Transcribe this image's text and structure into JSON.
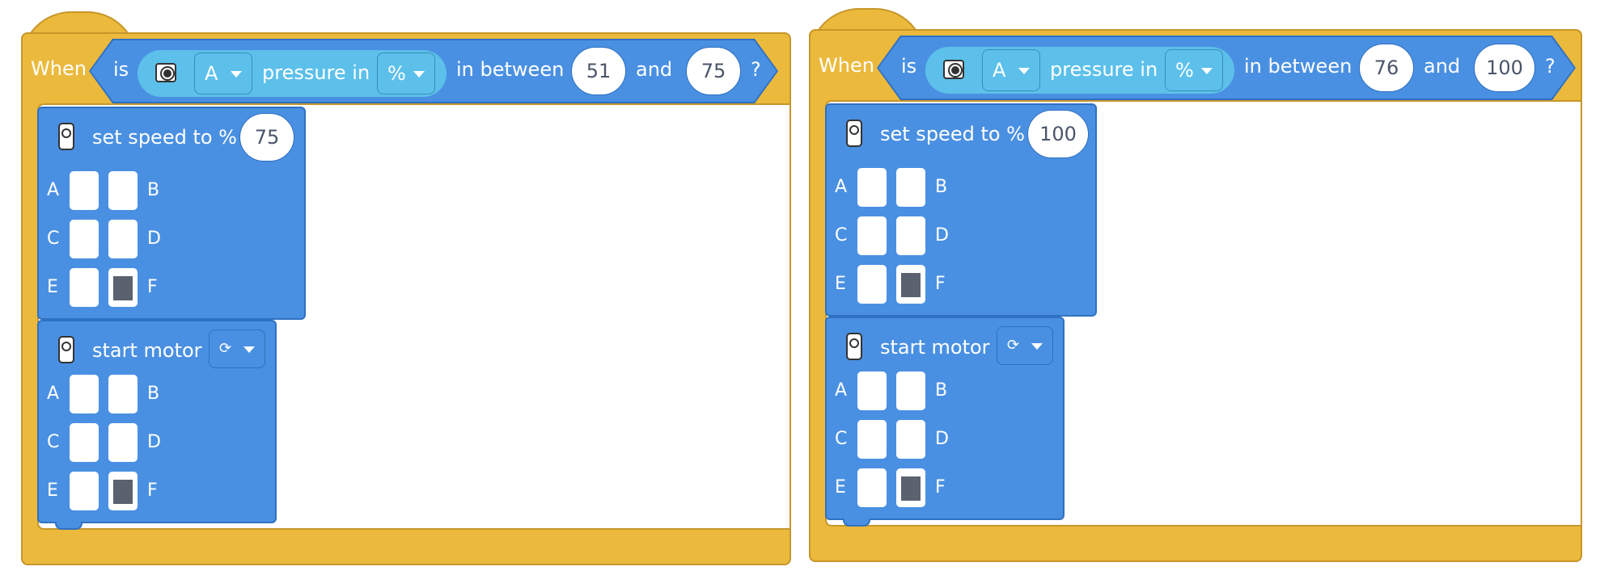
{
  "scripts": [
    {
      "when_label": "When",
      "is_label": "is",
      "port_value": "A",
      "pressure_label": "pressure in",
      "unit_value": "%",
      "between_label": "in between",
      "low": "51",
      "and_label": "and",
      "high": "75",
      "question": "?",
      "set_speed_label": "set speed to %",
      "speed_value": "75",
      "start_motor_label": "start motor",
      "direction_icon": "⟳",
      "port_letters": [
        "A",
        "B",
        "C",
        "D",
        "E",
        "F"
      ]
    },
    {
      "when_label": "When",
      "is_label": "is",
      "port_value": "A",
      "pressure_label": "pressure in",
      "unit_value": "%",
      "between_label": "in between",
      "low": "76",
      "and_label": "and",
      "high": "100",
      "question": "?",
      "set_speed_label": "set speed to %",
      "speed_value": "100",
      "start_motor_label": "start motor",
      "direction_icon": "⟳",
      "port_letters": [
        "A",
        "B",
        "C",
        "D",
        "E",
        "F"
      ]
    }
  ],
  "selected_port": "F",
  "colors": {
    "event_yellow": "#ebb93c",
    "motor_blue": "#4a90e2",
    "sensor_cyan": "#5cc0ea"
  }
}
